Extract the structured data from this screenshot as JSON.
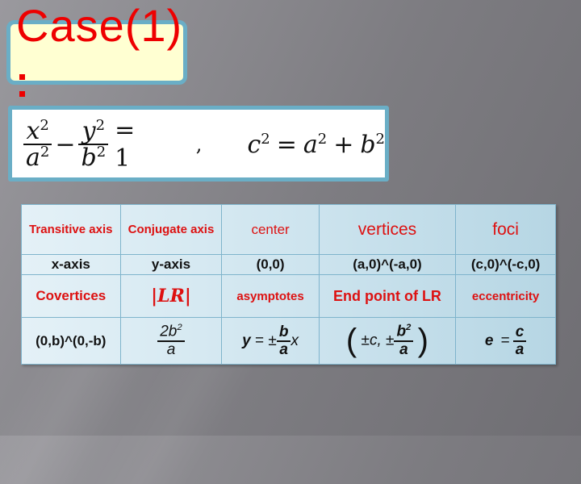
{
  "slide": {
    "title": "Case(1)",
    "title_suffix": ":",
    "colors": {
      "title": "#ee0000",
      "title_box_fill": "#ffffd2",
      "box_border": "#6aaec6",
      "header_text": "#dd1111",
      "value_text": "#111111"
    }
  },
  "equation": {
    "lhs_term1_num": "x",
    "lhs_term1_den": "a",
    "minus": "−",
    "lhs_term2_num": "y",
    "lhs_term2_den": "b",
    "exp": "2",
    "equals_one": "= 1",
    "separator": ",",
    "relation_c": "c",
    "relation_equals": "=",
    "relation_a": "a",
    "relation_plus": "+",
    "relation_b": "b"
  },
  "table": {
    "row1_headers": [
      "Transitive axis",
      "Conjugate axis",
      "center",
      "vertices",
      "foci"
    ],
    "row2_values": [
      "x-axis",
      "y-axis",
      "(0,0)",
      "(a,0)^(-a,0)",
      "(c,0)^(-c,0)"
    ],
    "row3_headers": [
      "Covertices",
      "|LR|",
      "asymptotes",
      "End point of LR",
      "eccentricity"
    ],
    "row4_values": {
      "covertices": "(0,b)^(0,-b)",
      "lr_num": "2b",
      "lr_num_exp": "2",
      "lr_den": "a",
      "asym_y": "y",
      "asym_eq": "= ±",
      "asym_num": "b",
      "asym_den": "a",
      "asym_x": "x",
      "endpoint_open": "(",
      "endpoint_c": "±c, ±",
      "endpoint_num": "b",
      "endpoint_num_exp": "2",
      "endpoint_den": "a",
      "endpoint_close": ")",
      "ecc_e": "e",
      "ecc_eq": "=",
      "ecc_num": "c",
      "ecc_den": "a"
    }
  }
}
